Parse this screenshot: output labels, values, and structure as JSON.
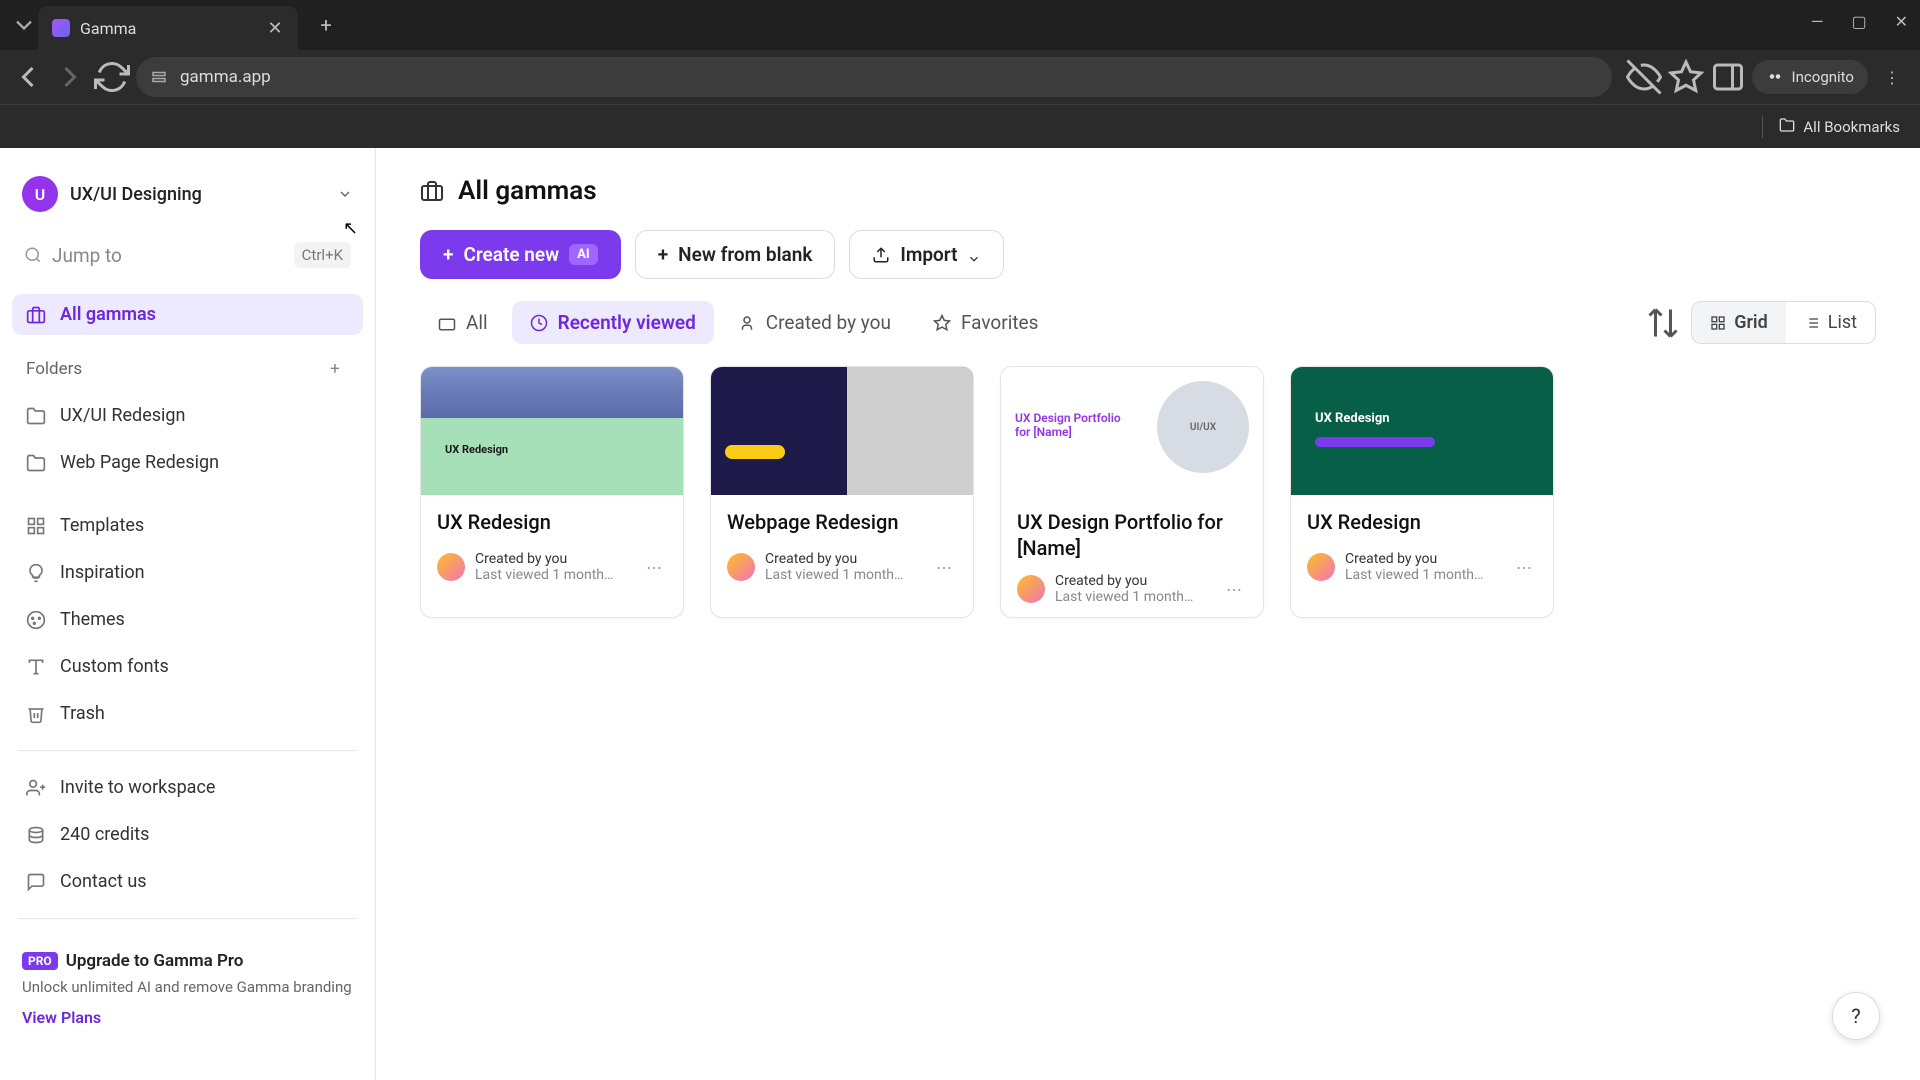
{
  "browser": {
    "tab_title": "Gamma",
    "url": "gamma.app",
    "incognito": "Incognito",
    "bookmarks_label": "All Bookmarks"
  },
  "sidebar": {
    "workspace_initial": "U",
    "workspace_name": "UX/UI Designing",
    "search_placeholder": "Jump to",
    "search_shortcut": "Ctrl+K",
    "all_gammas": "All gammas",
    "folders_label": "Folders",
    "folders": [
      {
        "label": "UX/UI Redesign"
      },
      {
        "label": "Web Page Redesign"
      }
    ],
    "nav": [
      {
        "label": "Templates"
      },
      {
        "label": "Inspiration"
      },
      {
        "label": "Themes"
      },
      {
        "label": "Custom fonts"
      },
      {
        "label": "Trash"
      }
    ],
    "footer": [
      {
        "label": "Invite to workspace"
      },
      {
        "label": "240 credits"
      },
      {
        "label": "Contact us"
      }
    ],
    "pro": {
      "badge": "PRO",
      "title": "Upgrade to Gamma Pro",
      "desc": "Unlock unlimited AI and remove Gamma branding",
      "link": "View Plans"
    }
  },
  "main": {
    "title": "All gammas",
    "actions": {
      "create": "Create new",
      "create_badge": "AI",
      "blank": "New from blank",
      "import": "Import"
    },
    "filters": {
      "all": "All",
      "recent": "Recently viewed",
      "created": "Created by you",
      "favorites": "Favorites"
    },
    "view": {
      "grid": "Grid",
      "list": "List"
    },
    "cards": [
      {
        "title": "UX Redesign",
        "creator": "Created by you",
        "viewed": "Last viewed 1 month…",
        "thumb_label": "UX Redesign"
      },
      {
        "title": "Webpage Redesign",
        "creator": "Created by you",
        "viewed": "Last viewed 1 month…",
        "thumb_label": ""
      },
      {
        "title": "UX Design Portfolio for [Name]",
        "creator": "Created by you",
        "viewed": "Last viewed 1 month…",
        "thumb_label": "UX Design Portfolio for [Name]",
        "circle": "UI/UX"
      },
      {
        "title": "UX Redesign",
        "creator": "Created by you",
        "viewed": "Last viewed 1 month…",
        "thumb_label": "UX Redesign"
      }
    ]
  },
  "help": "?"
}
